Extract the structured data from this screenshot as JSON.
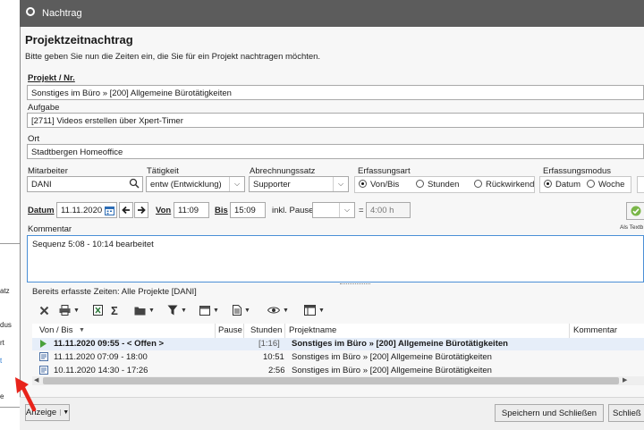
{
  "window": {
    "title": "Nachtrag"
  },
  "header": {
    "title": "Projektzeitnachtrag",
    "subtitle": "Bitte geben Sie nun die Zeiten ein, die Sie für ein Projekt nachtragen möchten."
  },
  "projekt": {
    "label": "Projekt / Nr.",
    "value": "Sonstiges im Büro » [200] Allgemeine Bürotätigkeiten"
  },
  "aufgabe": {
    "label": "Aufgabe",
    "value": "[2711] Videos erstellen über Xpert-Timer"
  },
  "ort": {
    "label": "Ort",
    "value": "Stadtbergen Homeoffice"
  },
  "mitarbeiter": {
    "label": "Mitarbeiter",
    "value": "DANI"
  },
  "taetigkeit": {
    "label": "Tätigkeit",
    "value": "entw (Entwicklung)"
  },
  "abrechnungssatz": {
    "label": "Abrechnungssatz",
    "value": "Supporter"
  },
  "erfassungsart": {
    "label": "Erfassungsart",
    "options": [
      "Von/Bis",
      "Stunden",
      "Rückwirkend"
    ],
    "selected": "Von/Bis"
  },
  "erfassungsmodus": {
    "label": "Erfassungsmodus",
    "options": [
      "Datum",
      "Woche"
    ],
    "selected": "Datum"
  },
  "zeit": {
    "datum_label": "Datum",
    "datum": "11.11.2020",
    "von_label": "Von",
    "von": "11:09",
    "bis_label": "Bis",
    "bis": "15:09",
    "pause_label": "inkl. Pause",
    "eq": "=",
    "dauer": "4:00 h"
  },
  "textbaustein": "Als Textb",
  "kommentar": {
    "label": "Kommentar",
    "value": "Sequenz 5:08 - 10:14 bearbeitet"
  },
  "bereits": {
    "label": "Bereits erfasste Zeiten: Alle Projekte [DANI]"
  },
  "table": {
    "columns": [
      "Von / Bis",
      "Pause",
      "Stunden",
      "Projektname",
      "Kommentar"
    ],
    "rows": [
      {
        "vonbis": "11.11.2020  09:55 - < Offen >",
        "pause": "",
        "stunden": "[1:16]",
        "projekt": "Sonstiges im Büro » [200] Allgemeine Bürotätigkeiten",
        "kommentar": ""
      },
      {
        "vonbis": "11.11.2020  07:09 - 18:00",
        "pause": "",
        "stunden": "10:51",
        "projekt": "Sonstiges im Büro » [200] Allgemeine Bürotätigkeiten",
        "kommentar": ""
      },
      {
        "vonbis": "10.11.2020  14:30 - 17:26",
        "pause": "",
        "stunden": "2:56",
        "projekt": "Sonstiges im Büro » [200] Allgemeine Bürotätigkeiten",
        "kommentar": ""
      }
    ]
  },
  "footer": {
    "anzeige": "Anzeige",
    "save_close": "Speichern und Schließen",
    "close": "Schließ"
  },
  "background_menu": [
    "atz",
    "dus",
    "rt",
    "t",
    "e"
  ],
  "colors": {
    "titlebar": "#5c5c5c",
    "arrow": "#e8231a",
    "row_highlight": "#e6eef9",
    "accent": "#2d7bd1"
  }
}
